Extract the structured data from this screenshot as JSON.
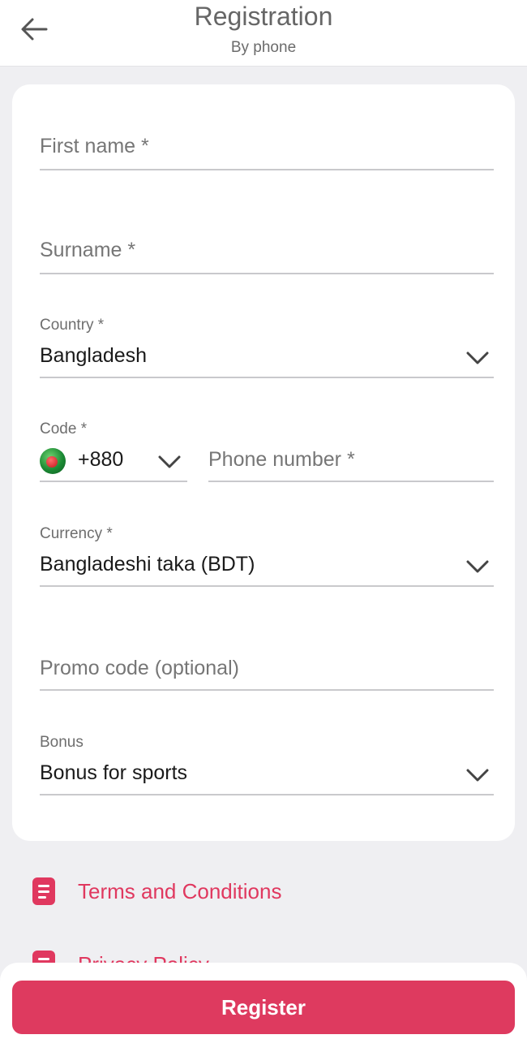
{
  "header": {
    "title": "Registration",
    "subtitle": "By phone",
    "back_icon": "arrow-left-icon"
  },
  "form": {
    "first_name": {
      "placeholder": "First name *",
      "value": ""
    },
    "surname": {
      "placeholder": "Surname *",
      "value": ""
    },
    "country": {
      "label": "Country *",
      "value": "Bangladesh"
    },
    "code": {
      "label": "Code *",
      "value": "+880",
      "flag": "bangladesh-flag-icon"
    },
    "phone": {
      "placeholder": "Phone number *",
      "value": ""
    },
    "currency": {
      "label": "Currency *",
      "value": "Bangladeshi taka (BDT)"
    },
    "promo": {
      "placeholder": "Promo code (optional)",
      "value": ""
    },
    "bonus": {
      "label": "Bonus",
      "value": "Bonus for sports"
    }
  },
  "links": [
    {
      "label": "Terms and Conditions",
      "icon": "document-icon"
    },
    {
      "label": "Privacy Policy",
      "icon": "document-icon"
    }
  ],
  "actions": {
    "register_label": "Register"
  },
  "colors": {
    "accent": "#de3a5f",
    "background": "#efeff2",
    "card": "#ffffff",
    "text_muted": "#767676"
  }
}
